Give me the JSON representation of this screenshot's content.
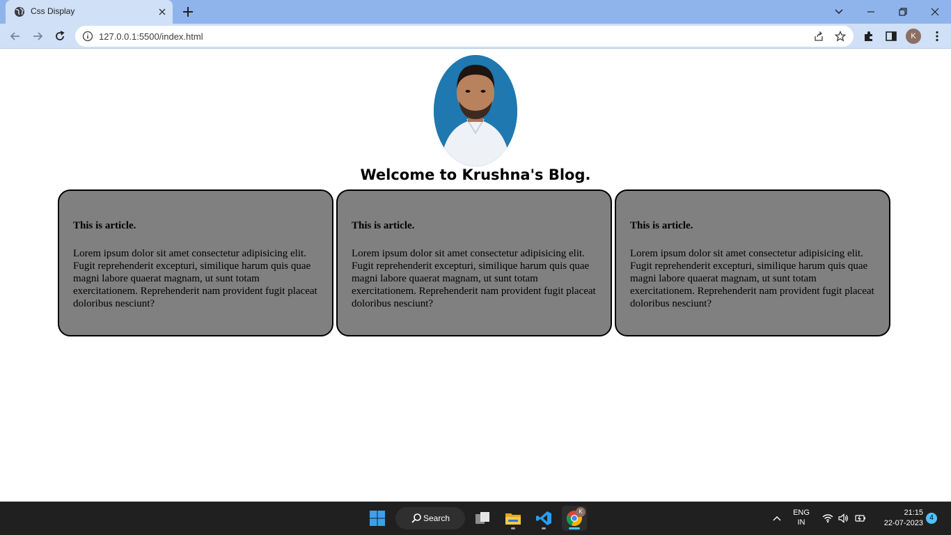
{
  "browser": {
    "tab_title": "Css Display",
    "url": "127.0.0.1:5500/index.html",
    "profile_initial": "K"
  },
  "page": {
    "heading": "Welcome to Krushna's Blog.",
    "articles": [
      {
        "title": "This is article.",
        "body": "Lorem ipsum dolor sit amet consectetur adipisicing elit. Fugit reprehenderit excepturi, similique harum quis quae magni labore quaerat magnam, ut sunt totam exercitationem. Reprehenderit nam provident fugit placeat doloribus nesciunt?"
      },
      {
        "title": "This is article.",
        "body": "Lorem ipsum dolor sit amet consectetur adipisicing elit. Fugit reprehenderit excepturi, similique harum quis quae magni labore quaerat magnam, ut sunt totam exercitationem. Reprehenderit nam provident fugit placeat doloribus nesciunt?"
      },
      {
        "title": "This is article.",
        "body": "Lorem ipsum dolor sit amet consectetur adipisicing elit. Fugit reprehenderit excepturi, similique harum quis quae magni labore quaerat magnam, ut sunt totam exercitationem. Reprehenderit nam provident fugit placeat doloribus nesciunt?"
      }
    ]
  },
  "taskbar": {
    "search_label": "Search",
    "language_line1": "ENG",
    "language_line2": "IN",
    "time": "21:15",
    "date": "22-07-2023",
    "notification_count": "4",
    "chrome_badge": "K"
  },
  "colors": {
    "tabstrip": "#8fb4ec",
    "toolbar": "#cfe0f7",
    "article_bg": "#808080",
    "taskbar": "#202020",
    "accent": "#4cc2ff"
  }
}
